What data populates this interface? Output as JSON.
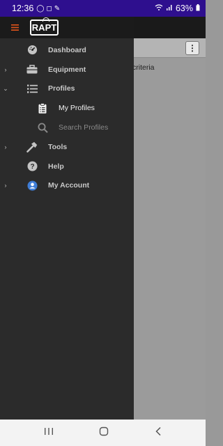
{
  "status": {
    "time": "12:36",
    "battery": "63%"
  },
  "background": {
    "text": "ch criteria"
  },
  "drawer": {
    "logo": "RAPT",
    "items": [
      {
        "label": "Dashboard",
        "icon": "gauge-icon",
        "expandable": false
      },
      {
        "label": "Equipment",
        "icon": "toolbox-icon",
        "expandable": true
      },
      {
        "label": "Profiles",
        "icon": "list-icon",
        "expandable": true,
        "expanded": true
      },
      {
        "label": "My Profiles",
        "icon": "clipboard-icon",
        "sub": true
      },
      {
        "label": "Search Profiles",
        "icon": "search-icon",
        "sub": true
      },
      {
        "label": "Tools",
        "icon": "hammer-icon",
        "expandable": true
      },
      {
        "label": "Help",
        "icon": "help-icon",
        "expandable": false
      },
      {
        "label": "My Account",
        "icon": "account-icon",
        "expandable": true
      }
    ]
  },
  "colors": {
    "status_bar": "#2e0f8e",
    "menu_accent": "#e2541b",
    "drawer_bg": "#2b2b2b",
    "account_icon": "#3f7dd6"
  }
}
